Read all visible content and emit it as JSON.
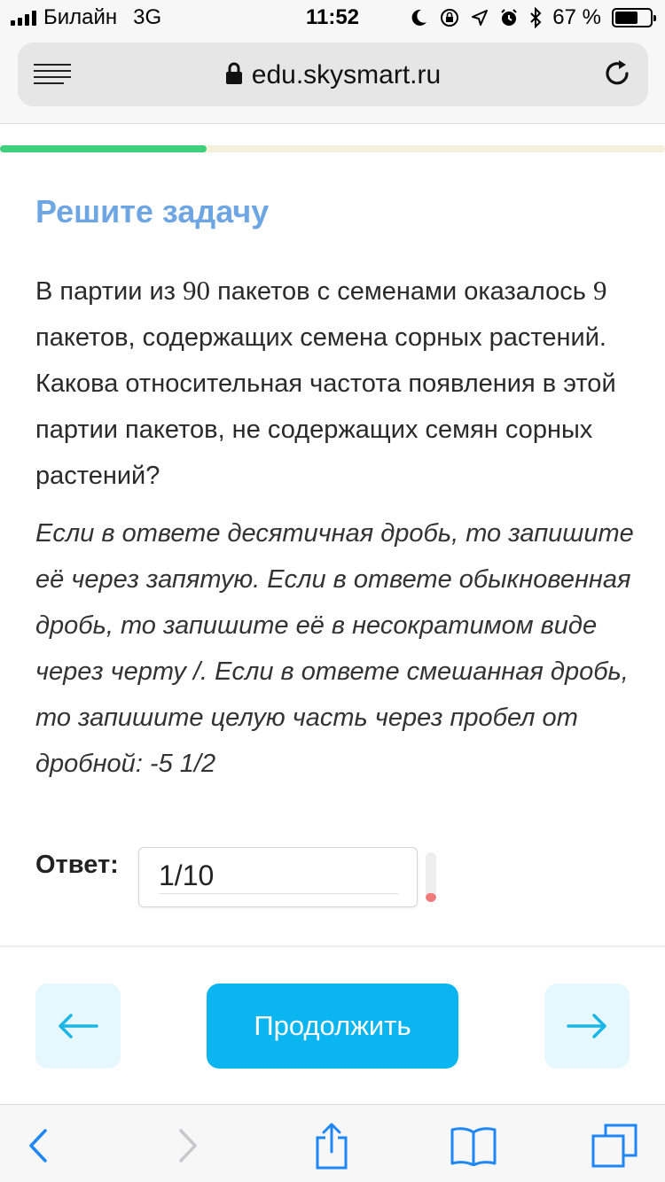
{
  "status_bar": {
    "carrier": "Билайн",
    "network": "3G",
    "time": "11:52",
    "battery": "67 %",
    "battery_level": 0.67
  },
  "browser": {
    "url": "edu.skysmart.ru"
  },
  "progress": {
    "fraction": 0.31,
    "fill_color": "#3fd07c",
    "track_color": "#f3f0dc"
  },
  "task": {
    "title": "Решите задачу",
    "problem_parts": {
      "p1": "В партии из ",
      "n1": "90",
      "p2": " пакетов с семенами оказалось ",
      "n2": "9",
      "p3": " пакетов, содержащих семена сорных растений. Какова относительная частота появления в этой партии пакетов, не содержащих семян сорных растений?"
    },
    "hint": "Если в ответе десятичная дробь, то запишите её через запятую. Если в ответе обыкновенная дробь, то запишите её в несократимом виде через черту /. Если в ответе смешанная дробь, то запишите целую часть через пробел от дробной: -5 1/2"
  },
  "answer": {
    "label": "Ответ:",
    "value": "1/10"
  },
  "navigation": {
    "prev_icon": "arrow-left-icon",
    "next_icon": "arrow-right-icon",
    "continue_label": "Продолжить"
  },
  "colors": {
    "title": "#6ea6e3",
    "continue_button": "#0bb5f0",
    "nav_button_bg": "#e6f8fd",
    "nav_arrow": "#1ab6e8",
    "safari_blue": "#1f86f5"
  }
}
